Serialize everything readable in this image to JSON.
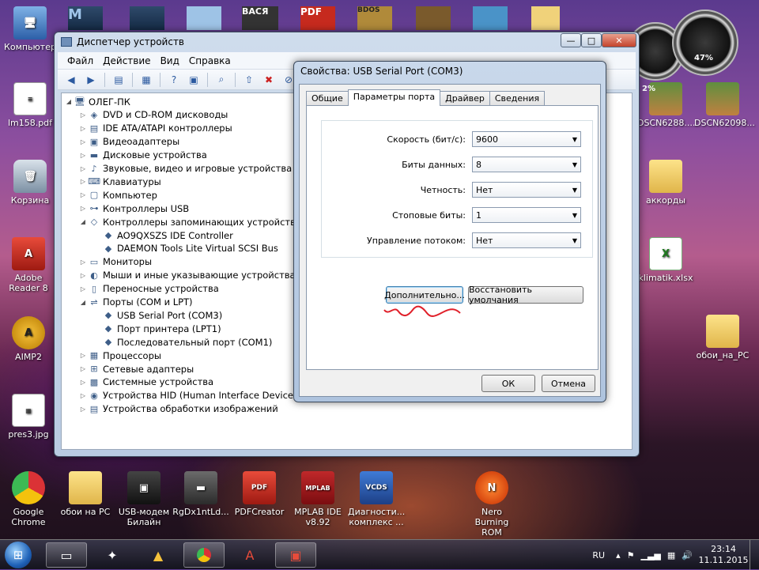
{
  "desktop": {
    "icons": [
      {
        "label": "Компьютер",
        "glyph": "🖥"
      },
      {
        "label": "lm158.pdf",
        "glyph": "≡"
      },
      {
        "label": "Корзина",
        "glyph": "🗑"
      },
      {
        "label": "Adobe Reader 8",
        "glyph": "A"
      },
      {
        "label": "AIMP2",
        "glyph": "A"
      },
      {
        "label": "pres3.jpg",
        "glyph": "▦"
      },
      {
        "label": "Google Chrome",
        "glyph": ""
      },
      {
        "label": "обои на PC",
        "glyph": ""
      },
      {
        "label": "USB-модем Билайн",
        "glyph": "▣"
      },
      {
        "label": "RgDx1ntLd...",
        "glyph": "▬"
      },
      {
        "label": "PDFCreator",
        "glyph": "PDF"
      },
      {
        "label": "MPLAB IDE v8.92",
        "glyph": "MPLAB"
      },
      {
        "label": "Диагности... комплекс ...",
        "glyph": "VCDS"
      },
      {
        "label": "Nero Burning ROM",
        "glyph": "N"
      },
      {
        "label": "DSCN6288....",
        "glyph": ""
      },
      {
        "label": "DSCN62098...",
        "glyph": ""
      },
      {
        "label": "аккорды",
        "glyph": ""
      },
      {
        "label": "klimatik.xlsx",
        "glyph": "X"
      },
      {
        "label": "обои_на_PC",
        "glyph": ""
      }
    ],
    "top_icons": [
      "M",
      "",
      "",
      "ВАСЯ",
      "PDF",
      "BDOS",
      "",
      "",
      ""
    ],
    "gadgets": {
      "cpu_percent": "2%",
      "memory_percent": "47%"
    }
  },
  "device_manager": {
    "title": "Диспетчер устройств",
    "menu": [
      "Файл",
      "Действие",
      "Вид",
      "Справка"
    ],
    "tree": [
      {
        "label": "ОЛЕГ-ПК",
        "level": 0,
        "expanded": true,
        "icon": "computer-icon"
      },
      {
        "label": "DVD и CD-ROM дисководы",
        "level": 1
      },
      {
        "label": "IDE ATA/ATAPI контроллеры",
        "level": 1
      },
      {
        "label": "Видеоадаптеры",
        "level": 1
      },
      {
        "label": "Дисковые устройства",
        "level": 1
      },
      {
        "label": "Звуковые, видео и игровые устройства",
        "level": 1
      },
      {
        "label": "Клавиатуры",
        "level": 1
      },
      {
        "label": "Компьютер",
        "level": 1
      },
      {
        "label": "Контроллеры USB",
        "level": 1
      },
      {
        "label": "Контроллеры запоминающих устройств",
        "level": 1,
        "expanded": true
      },
      {
        "label": "AO9QXSZS IDE Controller",
        "level": 2
      },
      {
        "label": "DAEMON Tools Lite Virtual SCSI Bus",
        "level": 2
      },
      {
        "label": "Мониторы",
        "level": 1
      },
      {
        "label": "Мыши и иные указывающие устройства",
        "level": 1
      },
      {
        "label": "Переносные устройства",
        "level": 1
      },
      {
        "label": "Порты (COM и LPT)",
        "level": 1,
        "expanded": true
      },
      {
        "label": "USB Serial Port (COM3)",
        "level": 2
      },
      {
        "label": "Порт принтера (LPT1)",
        "level": 2
      },
      {
        "label": "Последовательный порт (COM1)",
        "level": 2
      },
      {
        "label": "Процессоры",
        "level": 1
      },
      {
        "label": "Сетевые адаптеры",
        "level": 1
      },
      {
        "label": "Системные устройства",
        "level": 1
      },
      {
        "label": "Устройства HID (Human Interface Devices)",
        "level": 1
      },
      {
        "label": "Устройства обработки изображений",
        "level": 1
      }
    ]
  },
  "properties": {
    "title": "Свойства: USB Serial Port (COM3)",
    "tabs": [
      "Общие",
      "Параметры порта",
      "Драйвер",
      "Сведения"
    ],
    "active_tab": 1,
    "fields": [
      {
        "label": "Скорость (бит/с):",
        "value": "9600"
      },
      {
        "label": "Биты данных:",
        "value": "8"
      },
      {
        "label": "Четность:",
        "value": "Нет"
      },
      {
        "label": "Стоповые биты:",
        "value": "1"
      },
      {
        "label": "Управление потоком:",
        "value": "Нет"
      }
    ],
    "advanced_label": "Дополнительно...",
    "restore_label": "Восстановить умолчания",
    "ok_label": "ОК",
    "cancel_label": "Отмена",
    "annotation_color": "#e0202a"
  },
  "taskbar": {
    "language": "RU",
    "time": "23:14",
    "date": "11.11.2015"
  }
}
